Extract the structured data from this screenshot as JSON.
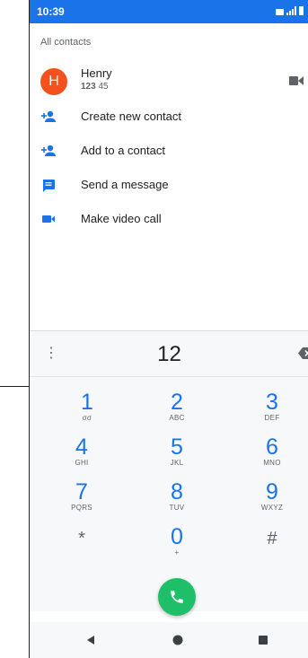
{
  "status_bar": {
    "time": "10:39"
  },
  "contacts": {
    "section_title": "All contacts",
    "contact": {
      "initial": "H",
      "name": "Henry",
      "number_highlight": "123",
      "number_rest": " 45"
    }
  },
  "actions": [
    {
      "label": "Create new contact",
      "icon": "person-add-icon"
    },
    {
      "label": "Add to a contact",
      "icon": "person-add-icon"
    },
    {
      "label": "Send a message",
      "icon": "message-icon"
    },
    {
      "label": "Make video call",
      "icon": "videocam-icon"
    }
  ],
  "dialpad": {
    "digits": "12",
    "keys": [
      {
        "num": "1",
        "sub": "σσ"
      },
      {
        "num": "2",
        "sub": "ABC"
      },
      {
        "num": "3",
        "sub": "DEF"
      },
      {
        "num": "4",
        "sub": "GHI"
      },
      {
        "num": "5",
        "sub": "JKL"
      },
      {
        "num": "6",
        "sub": "MNO"
      },
      {
        "num": "7",
        "sub": "PQRS"
      },
      {
        "num": "8",
        "sub": "TUV"
      },
      {
        "num": "9",
        "sub": "WXYZ"
      },
      {
        "num": "*",
        "sub": ""
      },
      {
        "num": "0",
        "sub": "+"
      },
      {
        "num": "#",
        "sub": ""
      }
    ]
  },
  "colors": {
    "accent": "#1a73e8",
    "call": "#1fbf6a",
    "avatar": "#f4511e"
  }
}
